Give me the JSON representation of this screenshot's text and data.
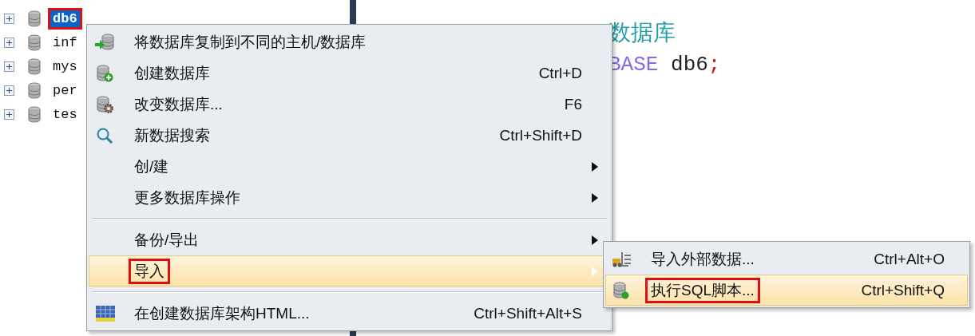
{
  "tree": [
    {
      "label": "db6",
      "selected": true,
      "expanded": false,
      "highlighted": true
    },
    {
      "label": "inf",
      "selected": false,
      "expanded": false,
      "highlighted": false
    },
    {
      "label": "mys",
      "selected": false,
      "expanded": false,
      "highlighted": false
    },
    {
      "label": "per",
      "selected": false,
      "expanded": false,
      "highlighted": false
    },
    {
      "label": "tes",
      "selected": false,
      "expanded": false,
      "highlighted": false
    }
  ],
  "editor": {
    "lines": [
      {
        "segments": [
          {
            "text": "数据库",
            "kind": "comment"
          }
        ]
      },
      {
        "segments": [
          {
            "text": "BASE",
            "kind": "keyword"
          },
          {
            "text": " db6",
            "kind": "ident"
          },
          {
            "text": ";",
            "kind": "punct"
          }
        ]
      }
    ]
  },
  "context_menu": {
    "items": [
      {
        "kind": "item",
        "label": "将数据库复制到不同的主机/数据库",
        "selected": false,
        "submenu": false,
        "highlighted": false
      },
      {
        "kind": "item",
        "label": "创建数据库",
        "shortcut": "Ctrl+D",
        "selected": false,
        "submenu": false,
        "highlighted": false
      },
      {
        "kind": "item",
        "label": "改变数据库...",
        "shortcut": "F6",
        "selected": false,
        "submenu": false,
        "highlighted": false
      },
      {
        "kind": "item",
        "label": "新数据搜索",
        "shortcut": "Ctrl+Shift+D",
        "selected": false,
        "submenu": false,
        "highlighted": false
      },
      {
        "kind": "item",
        "label": "创/建",
        "selected": false,
        "submenu": true,
        "highlighted": false
      },
      {
        "kind": "item",
        "label": "更多数据库操作",
        "selected": false,
        "submenu": true,
        "highlighted": false
      },
      {
        "kind": "separator"
      },
      {
        "kind": "item",
        "label": "备份/导出",
        "selected": false,
        "submenu": true,
        "highlighted": false
      },
      {
        "kind": "item",
        "label": "导入",
        "selected": true,
        "submenu": true,
        "highlighted": true
      },
      {
        "kind": "separator"
      },
      {
        "kind": "item",
        "label": "在创建数据库架构HTML...",
        "shortcut": "Ctrl+Shift+Alt+S",
        "selected": false,
        "submenu": false,
        "highlighted": false
      }
    ]
  },
  "submenu": {
    "items": [
      {
        "kind": "item",
        "label": "导入外部数据...",
        "shortcut": "Ctrl+Alt+O",
        "selected": false,
        "highlighted": false
      },
      {
        "kind": "item",
        "label": "执行SQL脚本...",
        "shortcut": "Ctrl+Shift+Q",
        "selected": true,
        "highlighted": true
      }
    ]
  }
}
